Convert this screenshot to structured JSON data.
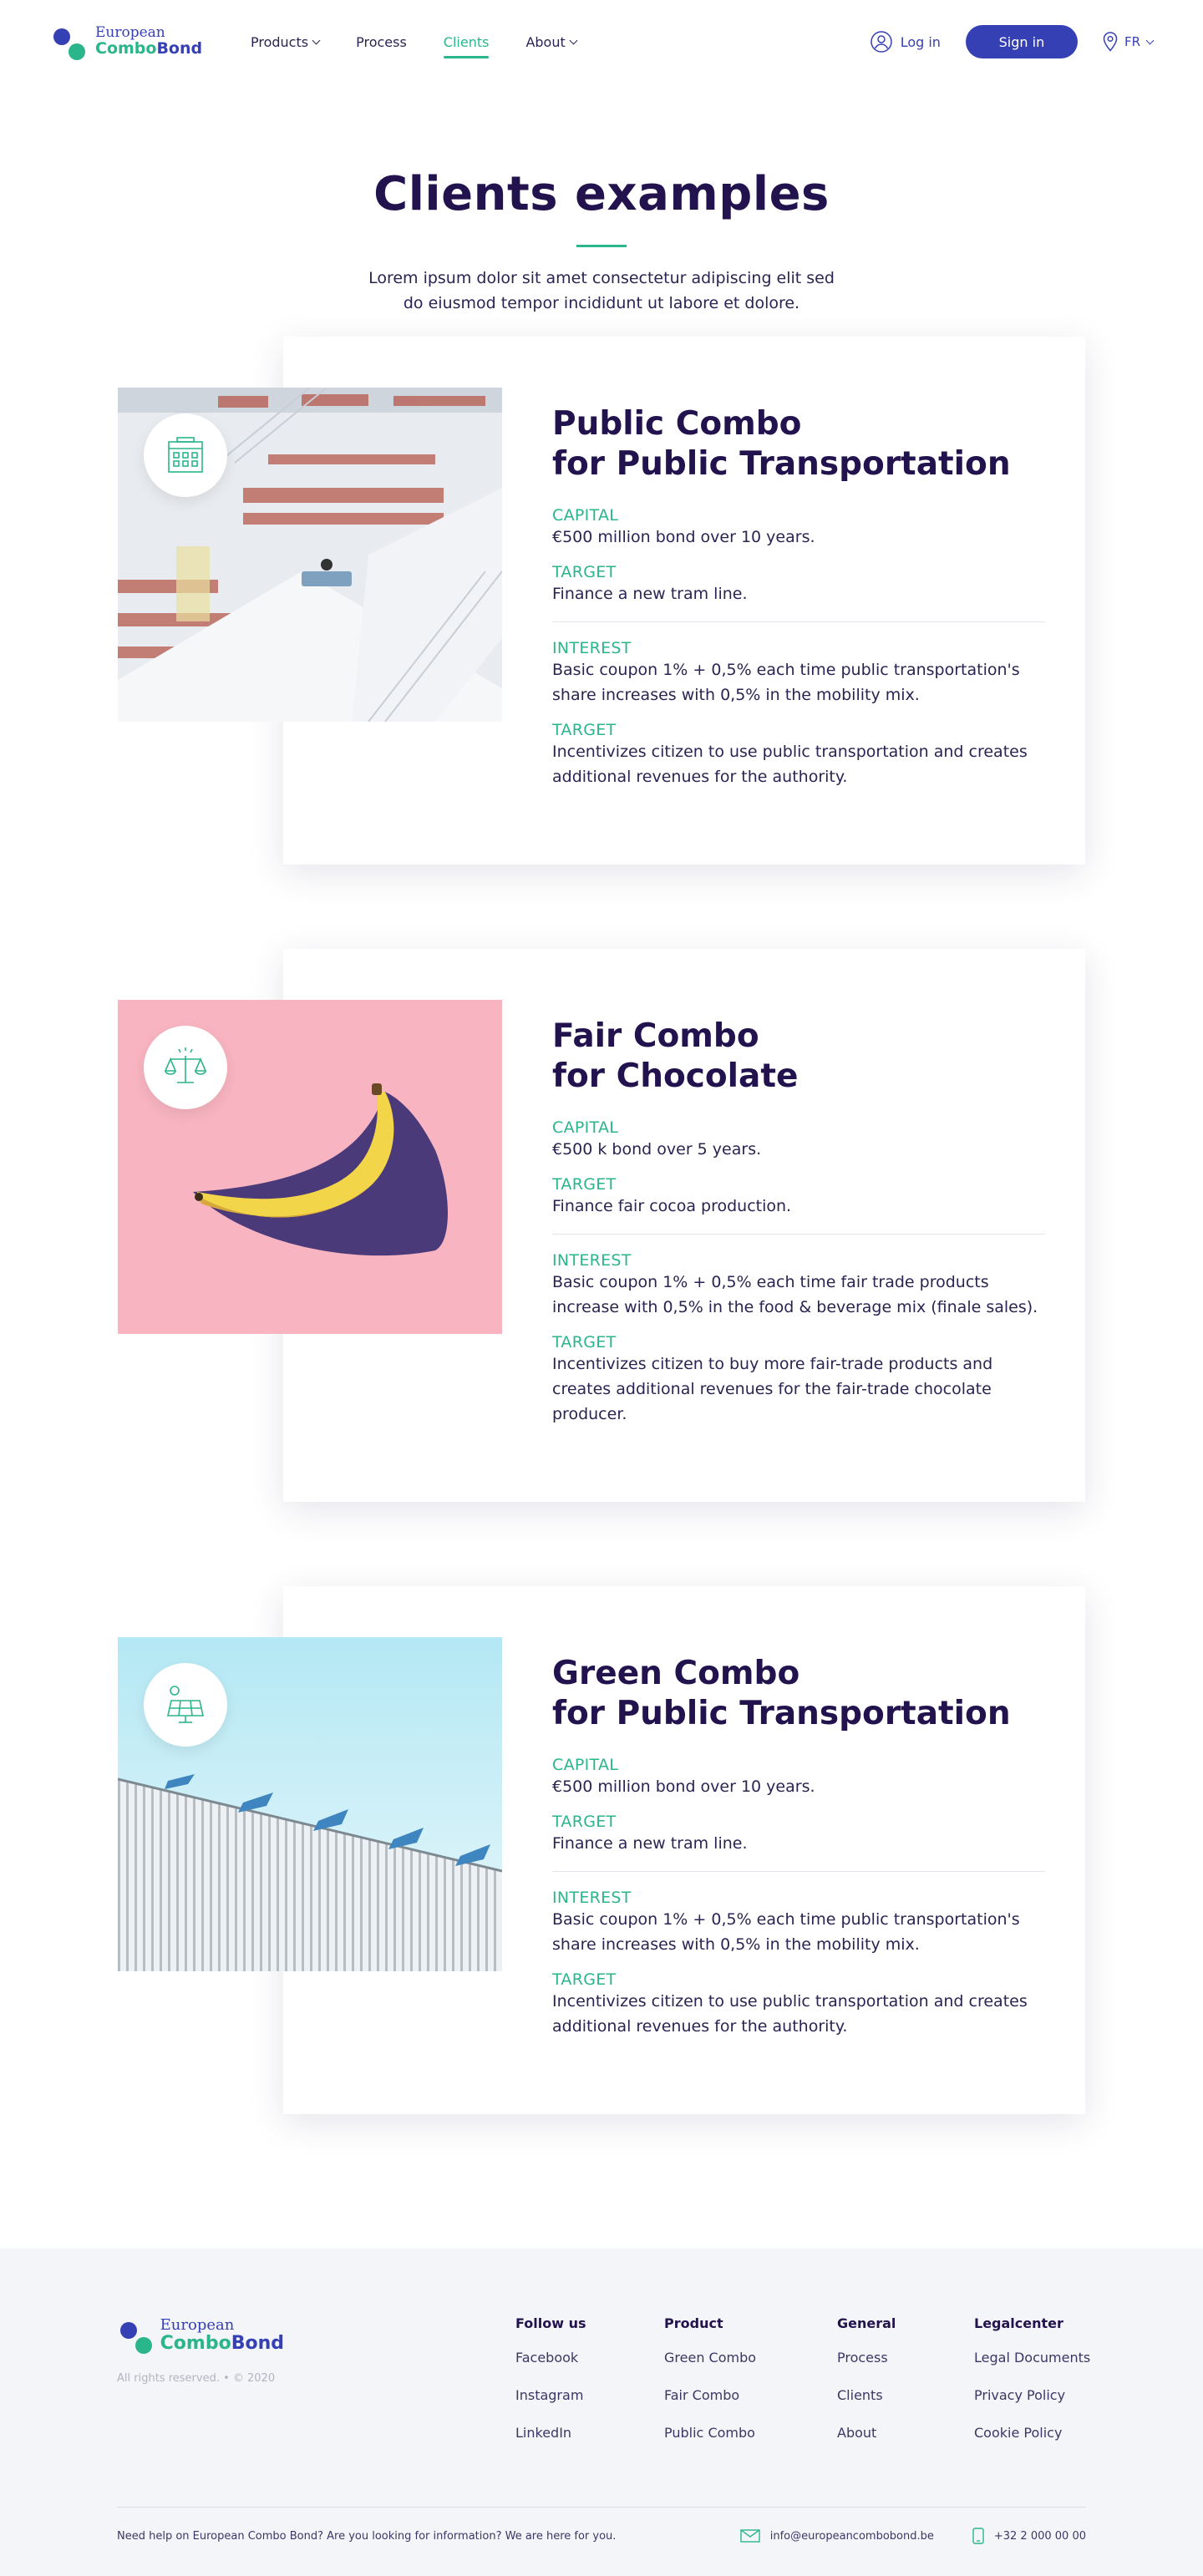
{
  "header": {
    "logo_line1": "European",
    "logo_combo": "Combo",
    "logo_bond": "Bond",
    "nav": [
      {
        "label": "Products"
      },
      {
        "label": "Process"
      },
      {
        "label": "Clients"
      },
      {
        "label": "About"
      }
    ],
    "login": "Log in",
    "signin": "Sign in",
    "lang": "FR"
  },
  "hero": {
    "title": "Clients examples",
    "subtitle": "Lorem ipsum dolor sit amet consectetur adipiscing elit sed do eiusmod tempor incididunt ut labore et dolore."
  },
  "clients": [
    {
      "title_line1": "Public Combo",
      "title_line2": "for Public Transportation",
      "icon": "building-icon",
      "capital_label": "CAPITAL",
      "capital_value": "€500 million bond over 10 years.",
      "target1_label": "TARGET",
      "target1_value": "Finance a new tram line.",
      "interest_label": "INTEREST",
      "interest_value": "Basic coupon 1% + 0,5% each time public transportation's share increases with 0,5% in the mobility mix.",
      "target2_label": "TARGET",
      "target2_value": "Incentivizes citizen to use public transportation and creates additional revenues for the authority."
    },
    {
      "title_line1": "Fair Combo",
      "title_line2": "for Chocolate",
      "icon": "scales-icon",
      "capital_label": "CAPITAL",
      "capital_value": "€500 k bond over 5 years.",
      "target1_label": "TARGET",
      "target1_value": "Finance fair cocoa production.",
      "interest_label": "INTEREST",
      "interest_value": "Basic coupon 1% + 0,5% each time fair trade products increase with 0,5% in the food & beverage mix (finale sales).",
      "target2_label": "TARGET",
      "target2_value": "Incentivizes citizen to buy more fair-trade products and creates additional revenues for the fair-trade chocolate producer."
    },
    {
      "title_line1": "Green Combo",
      "title_line2": "for Public Transportation",
      "icon": "solar-panel-icon",
      "capital_label": "CAPITAL",
      "capital_value": "€500 million bond over 10 years.",
      "target1_label": "TARGET",
      "target1_value": "Finance a new tram line.",
      "interest_label": "INTEREST",
      "interest_value": "Basic coupon 1% + 0,5% each time public transportation's share increases with 0,5% in the mobility mix.",
      "target2_label": "TARGET",
      "target2_value": "Incentivizes citizen to use public transportation and creates additional revenues for the authority."
    }
  ],
  "footer": {
    "logo_line1": "European",
    "logo_combo": "Combo",
    "logo_bond": "Bond",
    "rights": "All rights reserved. • © 2020",
    "columns": [
      {
        "title": "Follow us",
        "links": [
          "Facebook",
          "Instagram",
          "LinkedIn"
        ]
      },
      {
        "title": "Product",
        "links": [
          "Green Combo",
          "Fair Combo",
          "Public Combo"
        ]
      },
      {
        "title": "General",
        "links": [
          "Process",
          "Clients",
          "About"
        ]
      },
      {
        "title": "Legalcenter",
        "links": [
          "Legal Documents",
          "Privacy Policy",
          "Cookie Policy"
        ]
      }
    ],
    "help": "Need help on European Combo Bond? Are you looking for information? We are here for you.",
    "email": "info@europeancombobond.be",
    "phone": "+32 2 000 00 00"
  },
  "colors": {
    "brand_blue": "#3640b5",
    "brand_green": "#2bb58a",
    "heading": "#22134e"
  }
}
